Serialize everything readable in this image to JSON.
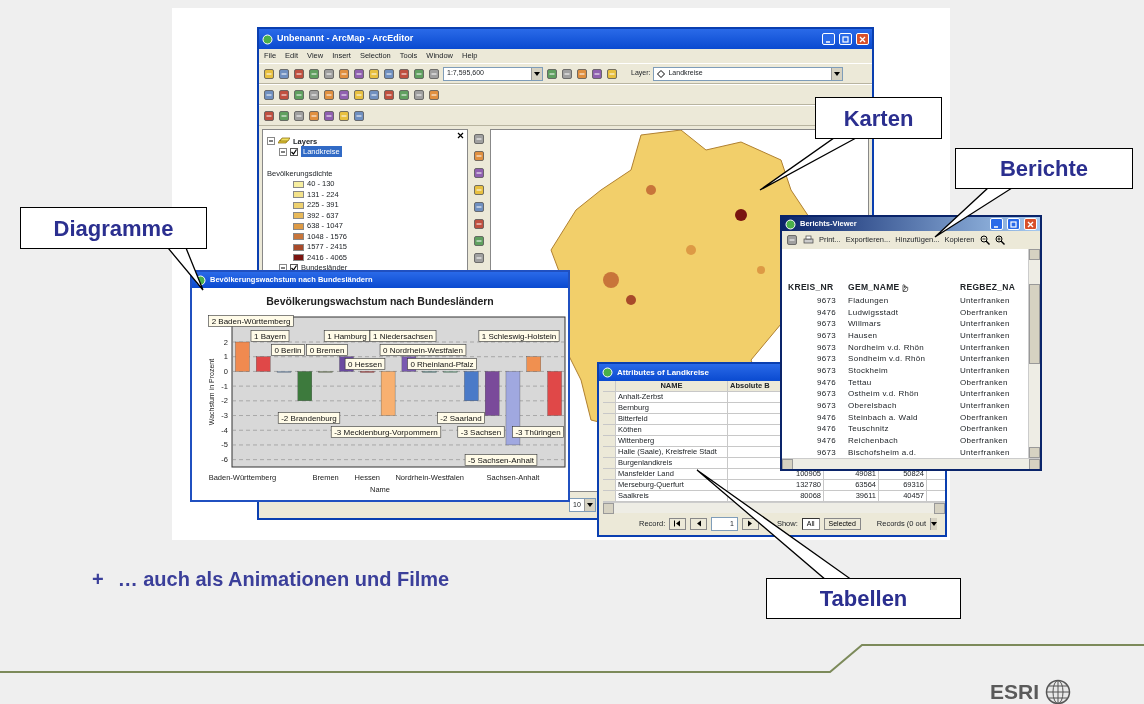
{
  "arcmap": {
    "title": "Unbenannt - ArcMap - ArcEditor",
    "menu": [
      "File",
      "Edit",
      "View",
      "Insert",
      "Selection",
      "Tools",
      "Window",
      "Help"
    ],
    "scale": "1:7,595,600",
    "layer_label": "Layer:",
    "layer": "Landkreise",
    "zoom_value": "10",
    "toc": {
      "label": "Layers",
      "expanded": true,
      "children": [
        {
          "label": "Landkreise",
          "checked": true,
          "selected": true,
          "expanded": true,
          "legend": {
            "title": "Bevölkerungsdichte",
            "classes": [
              {
                "label": "40 - 130",
                "color": "#f6eea0"
              },
              {
                "label": "131 - 224",
                "color": "#f3e28a"
              },
              {
                "label": "225 - 391",
                "color": "#eed170"
              },
              {
                "label": "392 - 637",
                "color": "#e8b95a"
              },
              {
                "label": "638 - 1047",
                "color": "#dd9a45"
              },
              {
                "label": "1048 - 1576",
                "color": "#c8753a"
              },
              {
                "label": "1577 - 2415",
                "color": "#a84a2a"
              },
              {
                "label": "2416 - 4065",
                "color": "#7a1410"
              }
            ]
          }
        },
        {
          "label": "Bundesländer",
          "checked": true,
          "selected": false,
          "expanded": true
        }
      ]
    }
  },
  "chart_window": {
    "title": "Bevölkerungswachstum nach Bundesländern",
    "chart_data": {
      "type": "bar",
      "title": "Bevölkerungswachstum nach Bundesländern",
      "xlabel": "Name",
      "ylabel": "Wachstum in Prozent",
      "series": [
        {
          "values": [
            2,
            1,
            0,
            -2,
            0,
            1,
            0,
            -3,
            1,
            0,
            0,
            -2,
            -3,
            -5,
            1,
            -3
          ]
        }
      ],
      "categories": [
        "Baden-Württemberg",
        null,
        null,
        null,
        "Bremen",
        null,
        "Hessen",
        null,
        null,
        "Nordrhein-Westfalen",
        null,
        null,
        null,
        "Sachsen-Anhalt",
        null,
        null
      ],
      "ylim": [
        -6.5,
        3.7
      ],
      "grid": true,
      "colors": [
        "#f08a50",
        "#e04848",
        "#8fb0d8",
        "#3d7a3d",
        "#8a9a70",
        "#6a4aa0",
        "#c84040",
        "#f8b070",
        "#7a5ab0",
        "#6aa0a0",
        "#80c0a0",
        "#4a7ac8",
        "#7a4a9a",
        "#a0a8e0",
        "#f09050",
        "#e04848"
      ],
      "yticks": [
        2,
        1,
        0,
        -1,
        -2,
        -3,
        -4,
        -5,
        -6
      ],
      "value_labels": [
        "2 Baden-Württemberg",
        "1 Bayern",
        "0 Berlin",
        "-2 Brandenburg",
        "0 Bremen",
        "1 Hamburg",
        "0 Hessen",
        "-3 Mecklenburg-Vorpommern",
        "1 Niedersachsen",
        "0 Nordrhein-Westfalen",
        "0 Rheinland-Pfalz",
        "-2 Saarland",
        "-3 Sachsen",
        "-5 Sachsen-Anhalt",
        "1 Schleswig-Holstein",
        "-3 Thüringen"
      ]
    }
  },
  "attributes": {
    "title": "Attributes of Landkreise",
    "columns": [
      "NAME",
      "Absolute B"
    ],
    "rows": [
      {
        "name": "Anhalt-Zerbst"
      },
      {
        "name": "Bernburg"
      },
      {
        "name": "Bitterfeld"
      },
      {
        "name": "Köthen"
      },
      {
        "name": "Wittenberg"
      },
      {
        "name": "Halle (Saale), Kreisfreie Stadt"
      },
      {
        "name": "Burgenlandkreis"
      },
      {
        "name": "Mansfelder Land",
        "values": [
          "100905",
          "49081",
          "50824"
        ]
      },
      {
        "name": "Merseburg-Querfurt",
        "values": [
          "132780",
          "63564",
          "69316"
        ]
      },
      {
        "name": "Saalkreis",
        "values": [
          "80068",
          "39611",
          "40457"
        ]
      }
    ],
    "record_label": "Record:",
    "record_value": "1",
    "show_label": "Show:",
    "show_options": [
      {
        "label": "All",
        "selected": true
      },
      {
        "label": "Selected",
        "selected": false
      }
    ],
    "records_info": "Records (0 out"
  },
  "report_viewer": {
    "title": "Berichts-Viewer",
    "toolbar": [
      "Print...",
      "Exportieren...",
      "Hinzufügen...",
      "Kopieren"
    ],
    "columns": [
      "KREIS_NR",
      "GEM_NAME",
      "REGBEZ_NA"
    ],
    "rows": [
      [
        "9673",
        "Fladungen",
        "Unterfranken"
      ],
      [
        "9476",
        "Ludwigsstadt",
        "Oberfranken"
      ],
      [
        "9673",
        "Willmars",
        "Unterfranken"
      ],
      [
        "9673",
        "Hausen",
        "Unterfranken"
      ],
      [
        "9673",
        "Nordheim v.d. Rhön",
        "Unterfranken"
      ],
      [
        "9673",
        "Sondheim v.d. Rhön",
        "Unterfranken"
      ],
      [
        "9673",
        "Stockheim",
        "Unterfranken"
      ],
      [
        "9476",
        "Tettau",
        "Oberfranken"
      ],
      [
        "9673",
        "Ostheim v.d. Rhön",
        "Unterfranken"
      ],
      [
        "9673",
        "Oberelsbach",
        "Unterfranken"
      ],
      [
        "9476",
        "Steinbach a. Wald",
        "Oberfranken"
      ],
      [
        "9476",
        "Teuschnitz",
        "Oberfranken"
      ],
      [
        "9476",
        "Reichenbach",
        "Oberfranken"
      ],
      [
        "9673",
        "Bischofsheim a.d.",
        "Unterfranken"
      ]
    ]
  },
  "callouts": [
    {
      "label": "Karten"
    },
    {
      "label": "Berichte"
    },
    {
      "label": "Diagramme"
    },
    {
      "label": "Tabellen"
    }
  ],
  "bullet": {
    "marker": "+",
    "text": "… auch als Animationen und Filme"
  },
  "logo": "ESRI"
}
